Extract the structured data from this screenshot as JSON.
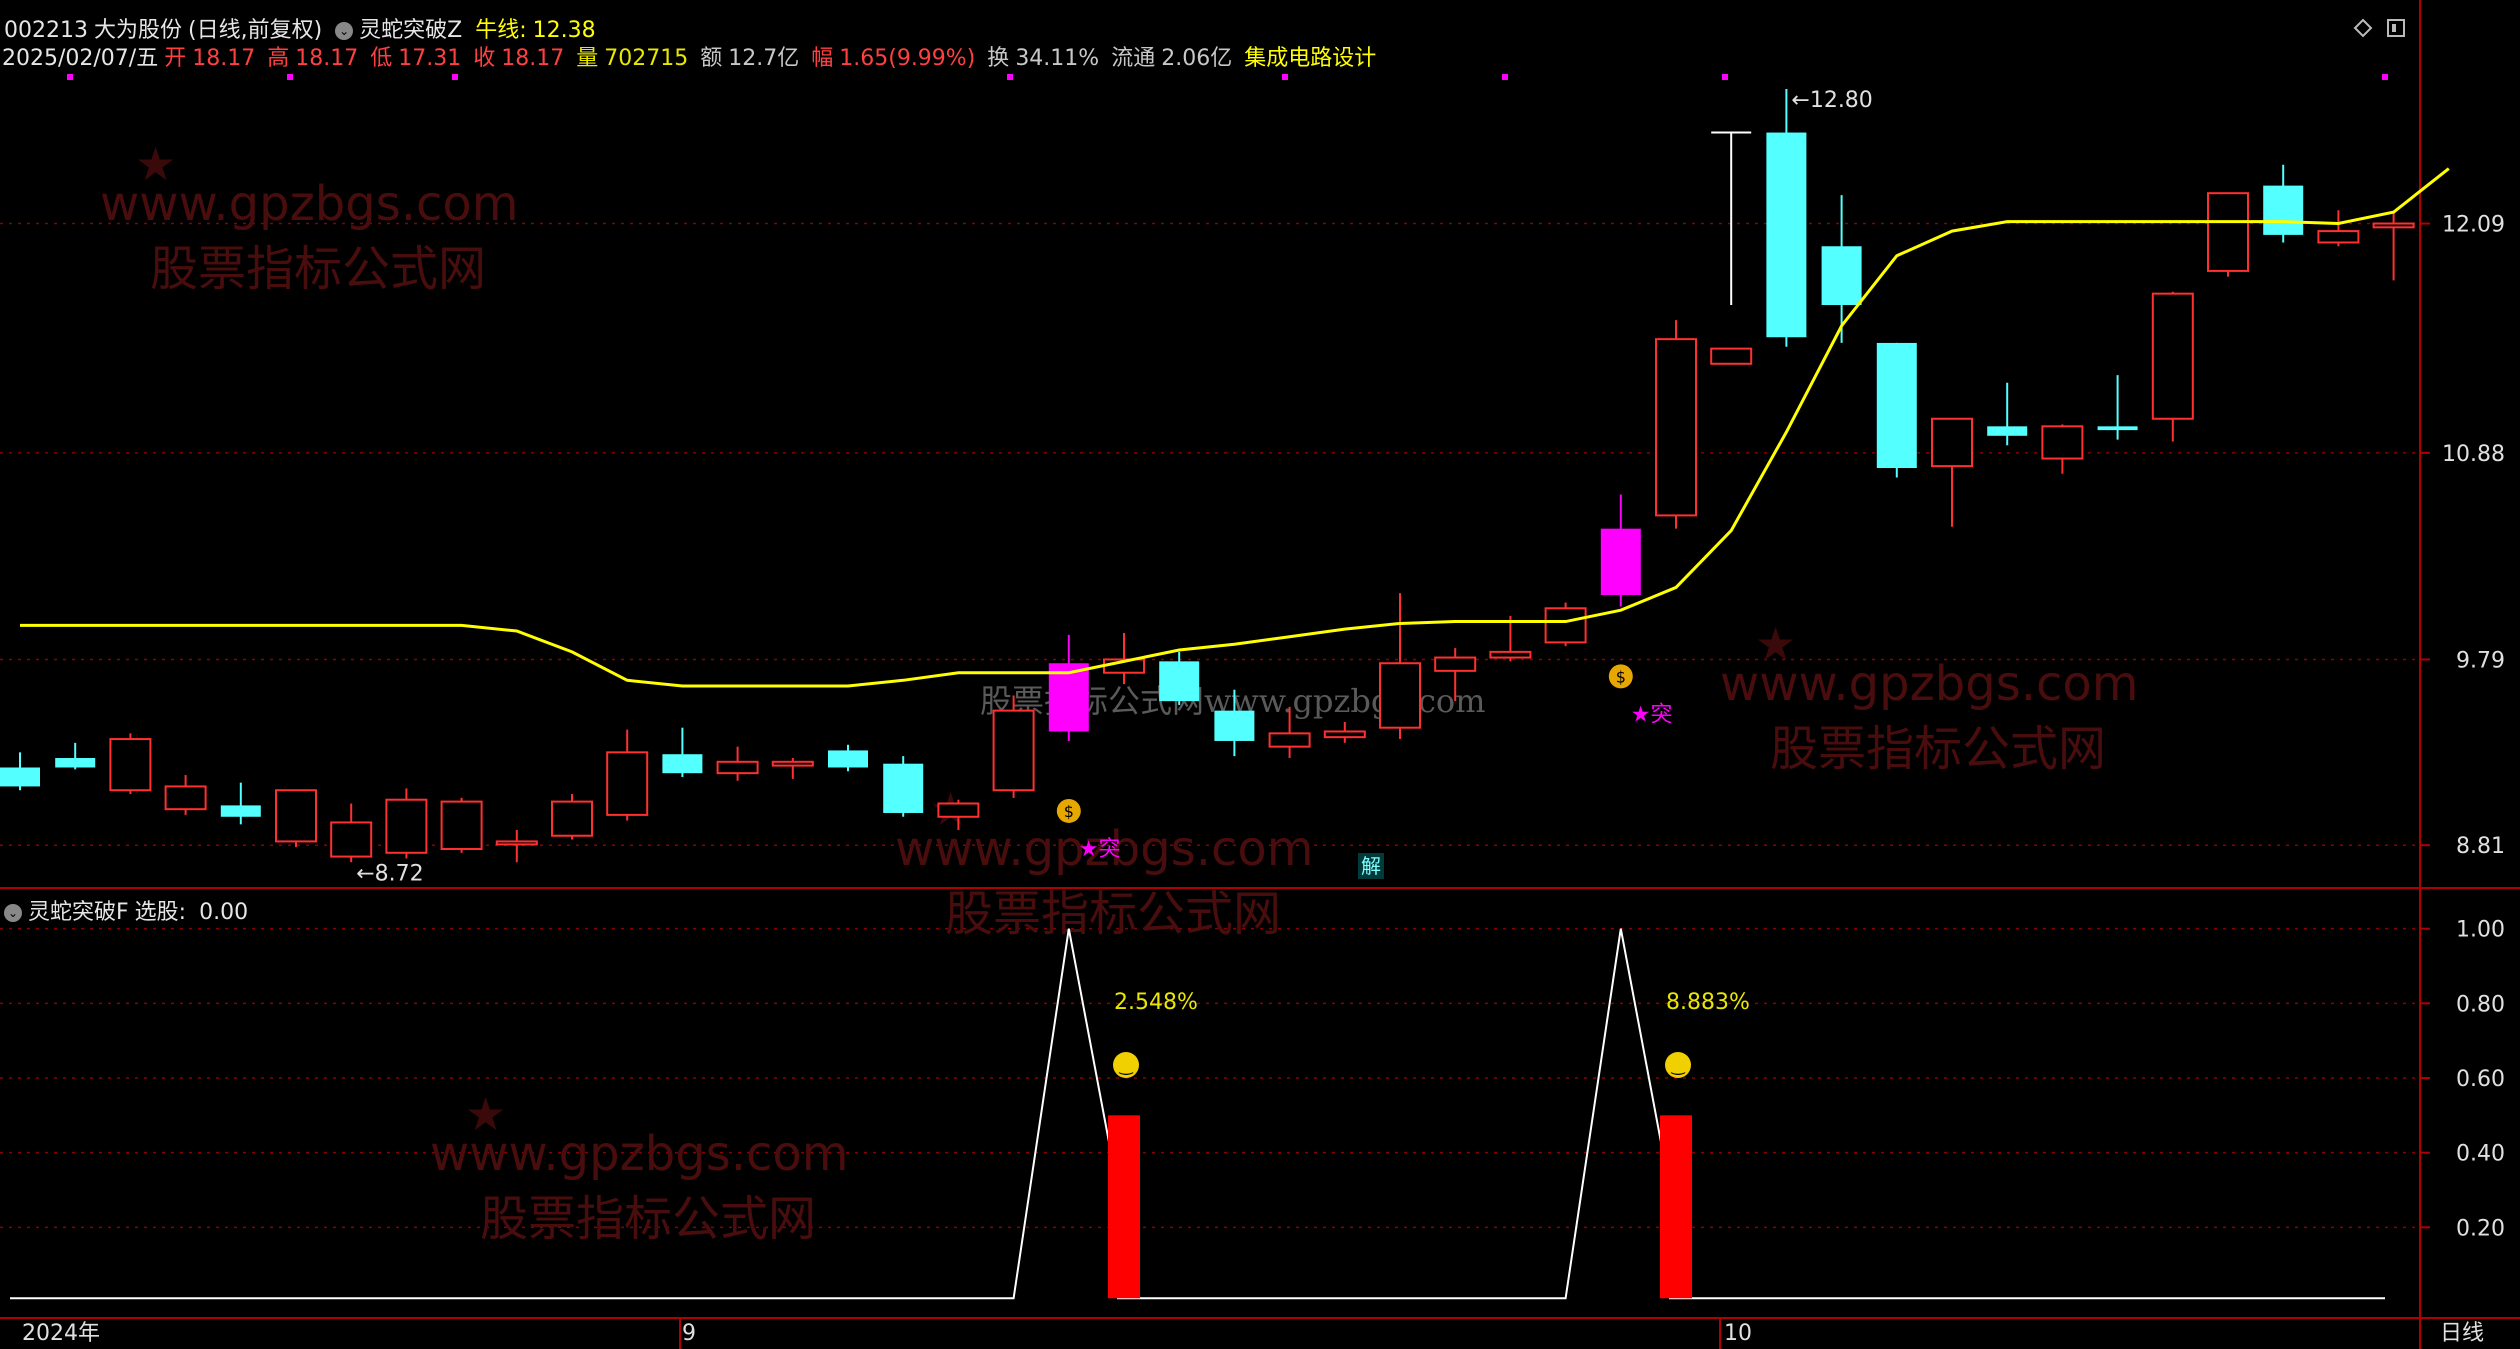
{
  "header": {
    "code": "002213",
    "name": "大为股份",
    "mode": "(日线,前复权)",
    "indicator_main": "灵蛇突破Z",
    "bull_label": "牛线:",
    "bull_value": "12.38",
    "date": "2025/02/07/五",
    "open_label": "开",
    "open": "18.17",
    "high_label": "高",
    "high": "18.17",
    "low_label": "低",
    "low": "17.31",
    "close_label": "收",
    "close": "18.17",
    "vol_label": "量",
    "vol": "702715",
    "amt_label": "额",
    "amt": "12.7亿",
    "chg_label": "幅",
    "chg": "1.65(9.99%)",
    "turn_label": "换",
    "turn": "34.11%",
    "float_label": "流通",
    "float": "2.06亿",
    "industry": "集成电路设计"
  },
  "sub_header": {
    "indicator": "灵蛇突破F",
    "select_label": "选股:",
    "select_value": "0.00"
  },
  "watermark": {
    "url": "www.gpzbgs.com",
    "cn": "股票指标公式网",
    "center": "股票指标公式网www.gpzbgs.com"
  },
  "footer": {
    "year_label": "2024年",
    "month_9": "9",
    "month_10": "10",
    "period": "日线"
  },
  "top_right_icons": [
    "diamond-icon",
    "window-icon"
  ],
  "colors": {
    "up": "#ff3030",
    "down": "#54ffff",
    "signal": "#ff00ff",
    "bull_line": "#ffff00",
    "grid": "#8b0000",
    "axis": "#b00000",
    "bar": "#ff0000"
  },
  "chart_data": [
    {
      "type": "candlestick",
      "y_axis_ticks": [
        12.09,
        10.88,
        9.79,
        8.81
      ],
      "price_range": [
        8.6,
        12.9
      ],
      "annotations": [
        {
          "text": "8.72",
          "candle": 6,
          "kind": "low"
        },
        {
          "text": "12.80",
          "candle": 32,
          "kind": "high"
        }
      ],
      "signals": [
        {
          "text": "★突",
          "candle": 19
        },
        {
          "text": "★突",
          "candle": 29
        }
      ],
      "money_icons": [
        19,
        29
      ],
      "misc_label": {
        "text": "解",
        "candle": 25
      },
      "candles": [
        {
          "o": 9.22,
          "h": 9.3,
          "l": 9.1,
          "c": 9.12
        },
        {
          "o": 9.27,
          "h": 9.35,
          "l": 9.21,
          "c": 9.22
        },
        {
          "o": 9.1,
          "h": 9.4,
          "l": 9.08,
          "c": 9.37
        },
        {
          "o": 9.0,
          "h": 9.18,
          "l": 8.97,
          "c": 9.12
        },
        {
          "o": 9.02,
          "h": 9.14,
          "l": 8.92,
          "c": 8.96
        },
        {
          "o": 8.83,
          "h": 9.05,
          "l": 8.8,
          "c": 9.1
        },
        {
          "o": 8.75,
          "h": 9.03,
          "l": 8.72,
          "c": 8.93
        },
        {
          "o": 8.77,
          "h": 9.11,
          "l": 8.74,
          "c": 9.05
        },
        {
          "o": 8.79,
          "h": 9.06,
          "l": 8.77,
          "c": 9.04
        },
        {
          "o": 8.83,
          "h": 8.89,
          "l": 8.72,
          "c": 8.83
        },
        {
          "o": 8.86,
          "h": 9.08,
          "l": 8.84,
          "c": 9.04
        },
        {
          "o": 8.97,
          "h": 9.42,
          "l": 8.94,
          "c": 9.3
        },
        {
          "o": 9.29,
          "h": 9.43,
          "l": 9.17,
          "c": 9.19
        },
        {
          "o": 9.19,
          "h": 9.33,
          "l": 9.15,
          "c": 9.25
        },
        {
          "o": 9.23,
          "h": 9.27,
          "l": 9.16,
          "c": 9.25
        },
        {
          "o": 9.31,
          "h": 9.34,
          "l": 9.2,
          "c": 9.22
        },
        {
          "o": 9.24,
          "h": 9.28,
          "l": 8.96,
          "c": 8.98
        },
        {
          "o": 8.96,
          "h": 9.05,
          "l": 8.89,
          "c": 9.03
        },
        {
          "o": 9.1,
          "h": 9.6,
          "l": 9.06,
          "c": 9.52
        },
        {
          "o": 9.41,
          "h": 9.92,
          "l": 9.36,
          "c": 9.77
        },
        {
          "o": 9.72,
          "h": 9.93,
          "l": 9.66,
          "c": 9.79
        },
        {
          "o": 9.78,
          "h": 9.83,
          "l": 9.55,
          "c": 9.57
        },
        {
          "o": 9.52,
          "h": 9.63,
          "l": 9.28,
          "c": 9.36
        },
        {
          "o": 9.33,
          "h": 9.54,
          "l": 9.27,
          "c": 9.4
        },
        {
          "o": 9.38,
          "h": 9.46,
          "l": 9.35,
          "c": 9.41
        },
        {
          "o": 9.43,
          "h": 10.14,
          "l": 9.37,
          "c": 9.77
        },
        {
          "o": 9.73,
          "h": 9.85,
          "l": 9.57,
          "c": 9.8
        },
        {
          "o": 9.8,
          "h": 10.02,
          "l": 9.78,
          "c": 9.83
        },
        {
          "o": 9.88,
          "h": 10.09,
          "l": 9.86,
          "c": 10.06
        },
        {
          "o": 10.13,
          "h": 10.66,
          "l": 10.07,
          "c": 10.48
        },
        {
          "o": 10.55,
          "h": 11.58,
          "l": 10.48,
          "c": 11.48
        },
        {
          "o": 11.35,
          "h": 11.43,
          "l": 11.35,
          "c": 11.43
        },
        {
          "o": 12.57,
          "h": 12.8,
          "l": 11.44,
          "c": 11.49
        },
        {
          "o": 11.97,
          "h": 12.24,
          "l": 11.46,
          "c": 11.66
        },
        {
          "o": 11.46,
          "h": 11.46,
          "l": 10.75,
          "c": 10.8
        },
        {
          "o": 10.81,
          "h": 11.02,
          "l": 10.49,
          "c": 11.06
        },
        {
          "o": 11.02,
          "h": 11.25,
          "l": 10.92,
          "c": 10.97
        },
        {
          "o": 10.85,
          "h": 11.03,
          "l": 10.77,
          "c": 11.02
        },
        {
          "o": 11.02,
          "h": 11.29,
          "l": 10.95,
          "c": 11.0
        },
        {
          "o": 11.06,
          "h": 11.73,
          "l": 10.94,
          "c": 11.72
        },
        {
          "o": 11.84,
          "h": 12.21,
          "l": 11.81,
          "c": 12.25
        },
        {
          "o": 12.29,
          "h": 12.4,
          "l": 11.99,
          "c": 12.03
        },
        {
          "o": 11.99,
          "h": 12.16,
          "l": 11.97,
          "c": 12.05
        },
        {
          "o": 12.07,
          "h": 12.15,
          "l": 11.79,
          "c": 12.09
        }
      ],
      "bull_line": [
        9.97,
        9.97,
        9.97,
        9.97,
        9.97,
        9.97,
        9.97,
        9.97,
        9.97,
        9.94,
        9.83,
        9.68,
        9.65,
        9.65,
        9.65,
        9.65,
        9.68,
        9.72,
        9.72,
        9.72,
        9.78,
        9.84,
        9.87,
        9.91,
        9.95,
        9.98,
        9.99,
        9.99,
        9.99,
        10.05,
        10.17,
        10.47,
        10.99,
        11.55,
        11.92,
        12.05,
        12.1,
        12.1,
        12.1,
        12.1,
        12.1,
        12.1,
        12.09,
        12.15,
        12.38
      ]
    },
    {
      "type": "line+bar",
      "y_axis_ticks": [
        1.0,
        0.8,
        0.6,
        0.4,
        0.2
      ],
      "y_range": [
        0,
        1.05
      ],
      "line_peaks": [
        {
          "start": 18,
          "peak": 19,
          "end": 20
        },
        {
          "start": 28,
          "peak": 29,
          "end": 30
        }
      ],
      "bars": [
        {
          "candle": 20,
          "value": 0.5
        },
        {
          "candle": 30,
          "value": 0.5
        }
      ],
      "labels": [
        {
          "candle": 20,
          "text": "2.548%"
        },
        {
          "candle": 30,
          "text": "8.883%"
        }
      ]
    }
  ]
}
